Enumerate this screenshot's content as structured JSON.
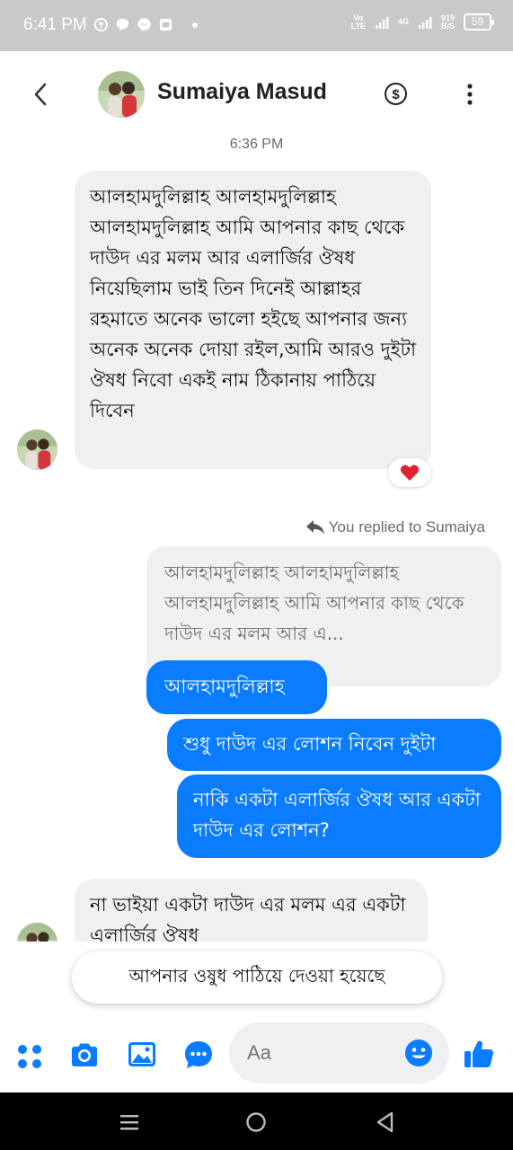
{
  "status_bar": {
    "time": "6:41 PM",
    "volte": "Vo\nLTE",
    "network": "4G",
    "speed": "919\nB/S",
    "battery": "59"
  },
  "header": {
    "contact_name": "Sumaiya Masud"
  },
  "messages": {
    "timestamp": "6:36 PM",
    "incoming_1": "আলহামদুলিল্লাহ আলহামদুলিল্লাহ আলহামদুলিল্লাহ আমি আপনার কাছ থেকে দাউদ এর মলম আর এলার্জির ঔষধ নিয়েছিলাম ভাই তিন দিনেই আল্লাহর রহমাতে অনেক ভালো হইছে আপনার জন্য অনেক অনেক দোয়া রইল,আমি আরও দুইটা ঔষধ নিবো একই নাম ঠিকানায় পাঠিয়ে দিবেন",
    "reaction": "❤",
    "replied_label": "You replied to Sumaiya",
    "quoted": "আলহামদুলিল্লাহ আলহামদুলিল্লাহ আলহামদুলিল্লাহ আমি আপনার কাছ থেকে দাউদ এর মলম আর এ...",
    "outgoing_1": "আলহামদুলিল্লাহ",
    "outgoing_2": "শুধু দাউদ এর লোশন নিবেন দুইটা",
    "outgoing_3": "নাকি একটা এলার্জির ঔষধ আর একটা দাউদ এর লোশন?",
    "incoming_2": "না ভাইয়া একটা দাউদ এর মলম এর একটা এলার্জির ঔষধ"
  },
  "toast": {
    "text": "আপনার ওষুধ পাঠিয়ে দেওয়া হয়েছে"
  },
  "composer": {
    "placeholder": "Aa"
  },
  "colors": {
    "accent": "#0a7cff",
    "incoming_bubble": "#f0f0f2",
    "status_bar": "#c9c9c9"
  }
}
